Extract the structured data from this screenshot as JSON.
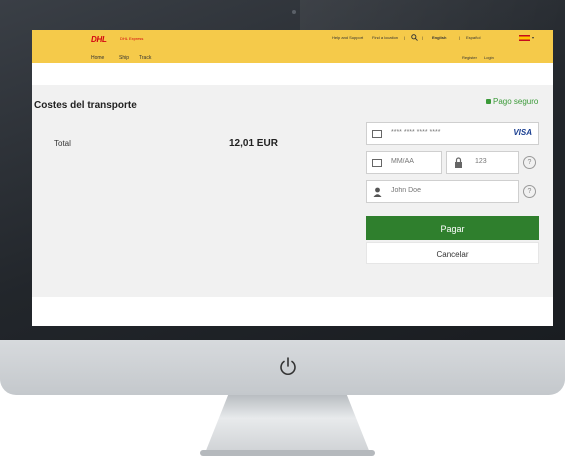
{
  "header": {
    "logo_text": "DHL",
    "logo_sub": "DHL Express",
    "utility": {
      "help": "Help and Support",
      "find": "Find a location",
      "separator": "|",
      "lang_en": "English",
      "lang_es": "Español"
    },
    "nav": [
      "Home",
      "Ship",
      "Track"
    ],
    "nav_right": {
      "register": "Register",
      "login": "Login"
    }
  },
  "payment": {
    "title": "Costes del transporte",
    "secure_label": "Pago seguro",
    "total_label": "Total",
    "total_value": "12,01 EUR",
    "card_placeholder": "**** **** **** ****",
    "card_brand": "VISA",
    "expiry_placeholder": "MM/AA",
    "cvc_placeholder": "123",
    "name_placeholder": "John Doe",
    "help_glyph": "?",
    "pay_label": "Pagar",
    "cancel_label": "Cancelar"
  },
  "colors": {
    "header_bg": "#f5ca4a",
    "brand_red": "#d40511",
    "pay_green": "#2f7f2d",
    "secure_green": "#3b9a39"
  },
  "icons": [
    "card-icon",
    "calendar-icon",
    "lock-icon",
    "user-icon",
    "help-icon",
    "power-icon",
    "search-icon",
    "flag-es-icon"
  ]
}
